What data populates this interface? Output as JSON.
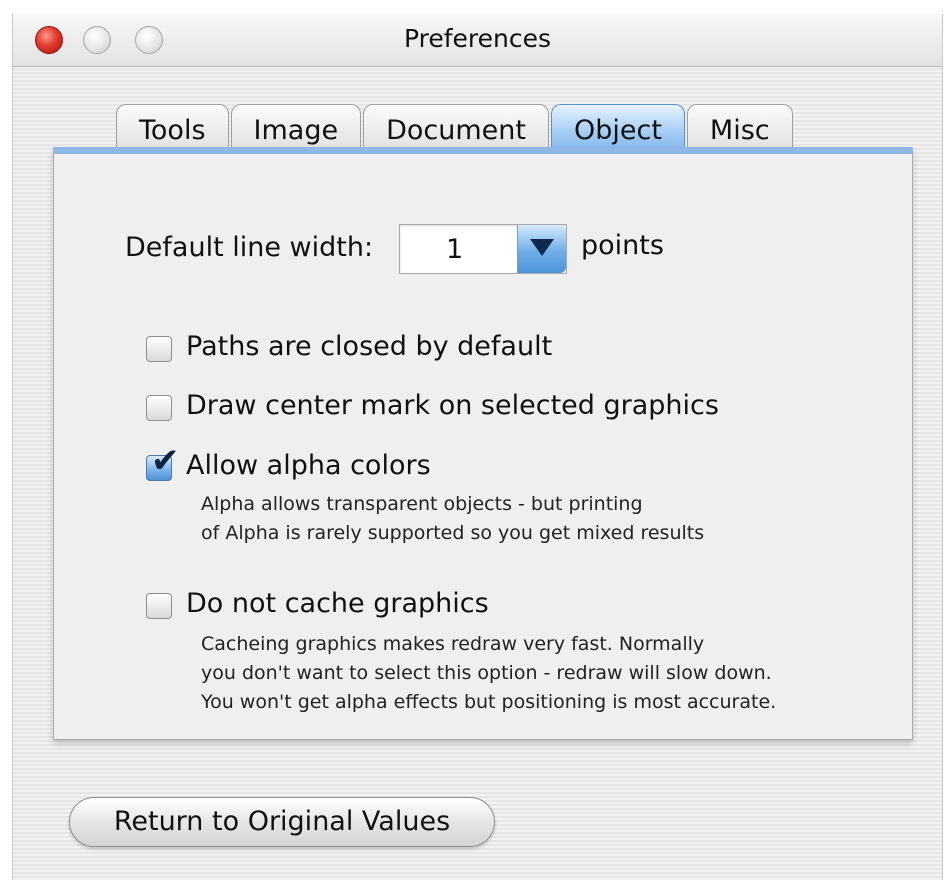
{
  "window": {
    "title": "Preferences"
  },
  "tabs": [
    {
      "label": "Tools"
    },
    {
      "label": "Image"
    },
    {
      "label": "Document"
    },
    {
      "label": "Object",
      "active": true
    },
    {
      "label": "Misc"
    }
  ],
  "object_panel": {
    "line_width": {
      "label": "Default line width:",
      "value": "1",
      "unit": "points"
    },
    "options": [
      {
        "label": "Paths are closed by default",
        "checked": false
      },
      {
        "label": "Draw center mark on selected graphics",
        "checked": false
      },
      {
        "label": "Allow alpha colors",
        "checked": true,
        "hint": [
          "Alpha allows transparent  objects - but printing",
          "of Alpha is rarely supported so you get mixed results"
        ]
      },
      {
        "label": "Do not cache graphics",
        "checked": false,
        "hint": [
          "Cacheing graphics makes redraw very fast. Normally",
          "you don't want to select this option - redraw will slow down.",
          "You won't get alpha effects but positioning is most accurate."
        ]
      }
    ]
  },
  "footer": {
    "return_button_label": "Return to Original Values"
  },
  "colors": {
    "selected_tab": "#8fb8e6",
    "close_button": "#e0392d"
  }
}
